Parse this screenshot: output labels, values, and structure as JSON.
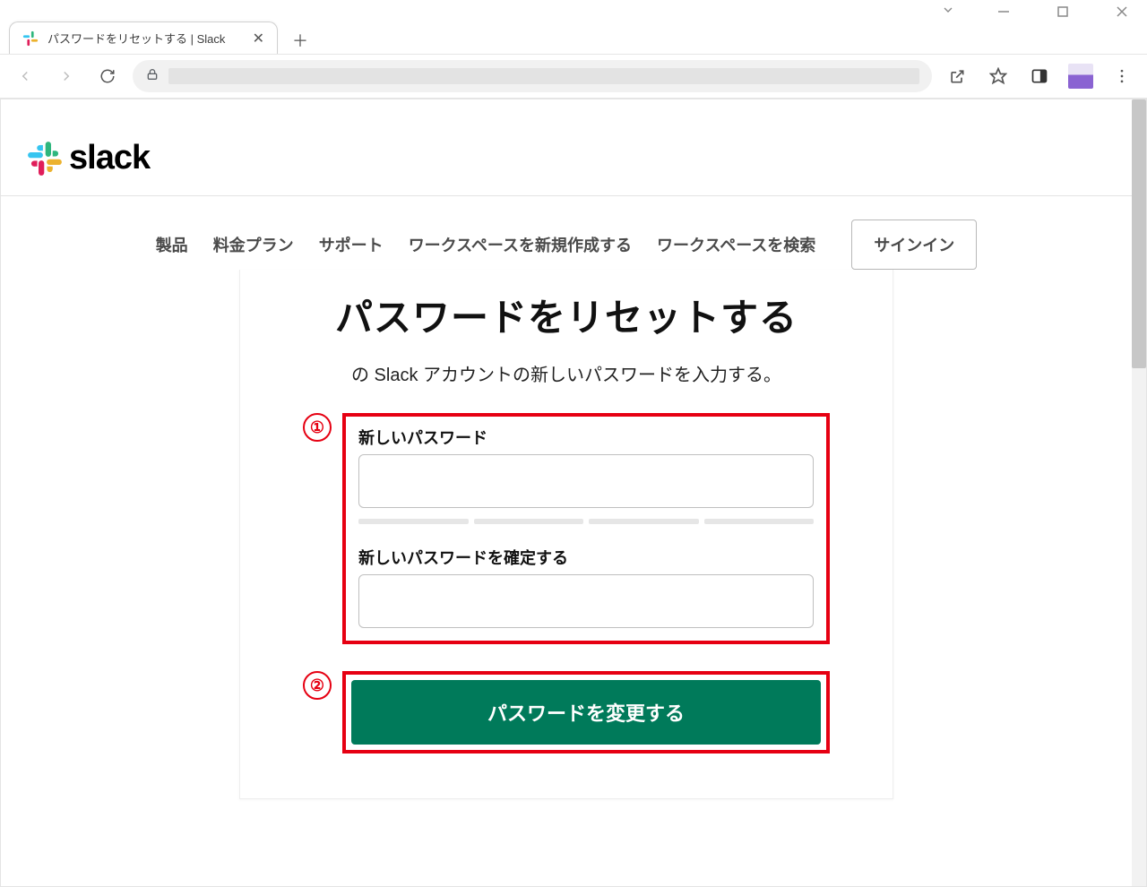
{
  "browser": {
    "tab_title": "パスワードをリセットする | Slack"
  },
  "nav": {
    "items": [
      "製品",
      "料金プラン",
      "サポート",
      "ワークスペースを新規作成する",
      "ワークスペースを検索"
    ],
    "signin": "サインイン"
  },
  "logo_text": "slack",
  "page": {
    "title": "パスワードをリセットする",
    "subtitle": "の Slack アカウントの新しいパスワードを入力する。",
    "label_new_password": "新しいパスワード",
    "label_confirm_password": "新しいパスワードを確定する",
    "submit_label": "パスワードを変更する"
  },
  "annotations": {
    "marker1": "①",
    "marker2": "②"
  }
}
